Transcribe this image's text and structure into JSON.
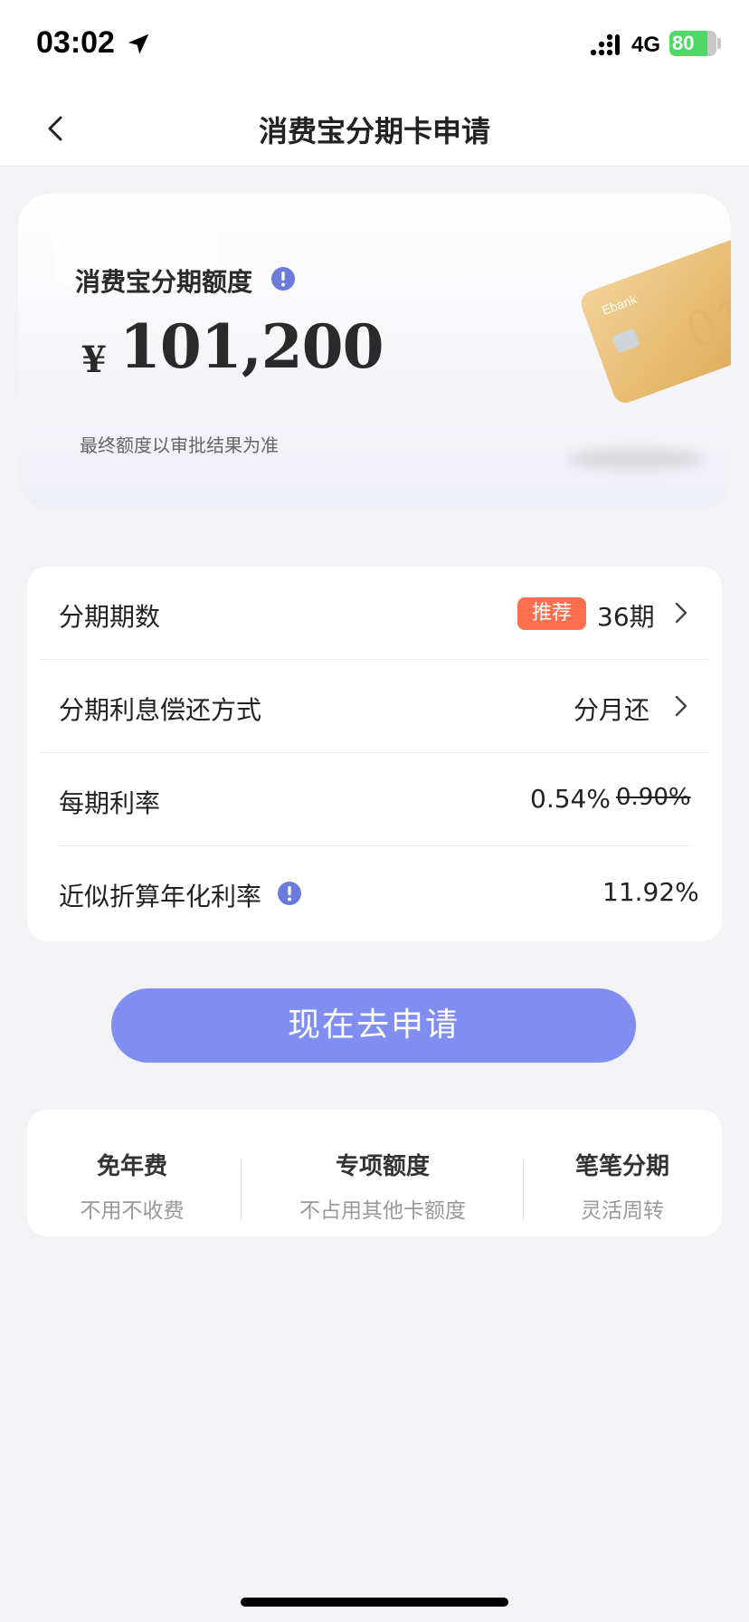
{
  "status_bar": {
    "time": "03:02",
    "network": "4G",
    "battery": "80",
    "icons": [
      "location-arrow-icon",
      "signal-icon",
      "battery-icon"
    ]
  },
  "nav": {
    "title": "消费宝分期卡申请",
    "back_icon": "chevron-left-icon"
  },
  "quota_card": {
    "label": "消费宝分期额度",
    "currency": "¥",
    "amount": "101,200",
    "note": "最终额度以审批结果为准",
    "info_icon": "info-icon"
  },
  "options": {
    "installments": {
      "label": "分期期数",
      "badge": "推荐",
      "value": "36期"
    },
    "repayment": {
      "label": "分期利息偿还方式",
      "value": "分月还"
    },
    "rate": {
      "label": "每期利率",
      "value": "0.54%",
      "original": "0.90%"
    },
    "annual_rate": {
      "label": "近似折算年化利率",
      "value": "11.92%"
    }
  },
  "apply_button": {
    "label": "现在去申请"
  },
  "features": [
    {
      "title": "免年费",
      "subtitle": "不用不收费"
    },
    {
      "title": "专项额度",
      "subtitle": "不占用其他卡额度"
    },
    {
      "title": "笔笔分期",
      "subtitle": "灵活周转"
    }
  ],
  "colors": {
    "accent": "#7f8ef0",
    "badge": "#ff6f4e",
    "info_icon": "#6b7bd9",
    "battery": "#4cd964"
  }
}
